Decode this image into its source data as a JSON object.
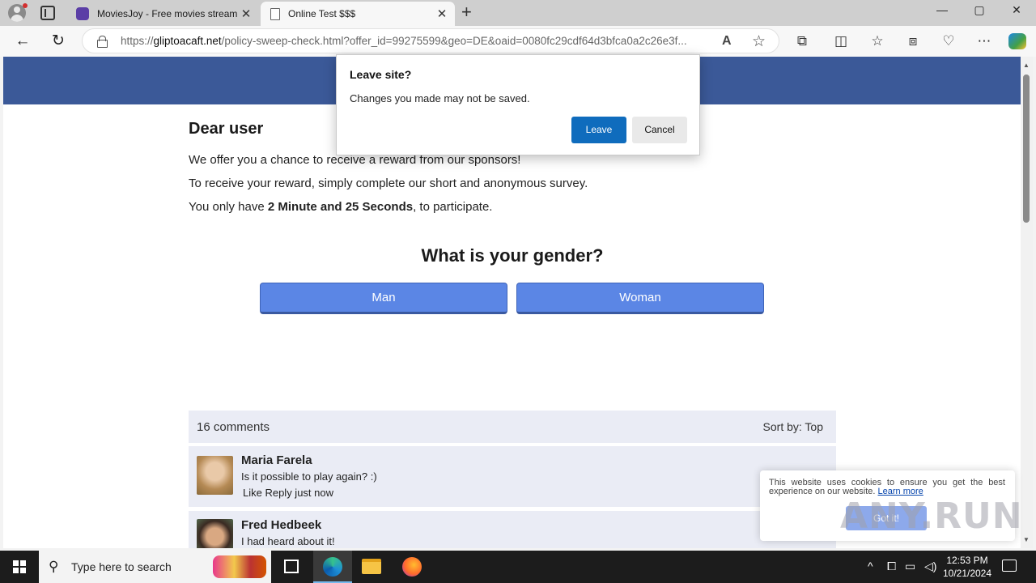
{
  "browser": {
    "tabs": [
      {
        "title": "MoviesJoy - Free movies streamin"
      },
      {
        "title": "Online Test $$$"
      }
    ],
    "url_prefix": "https://",
    "url_domain": "gliptoacaft.net",
    "url_rest": "/policy-sweep-check.html?offer_id=99275599&geo=DE&oaid=0080fc29cdf64d3bfca0a2c26e3f...",
    "win_controls": {
      "minimize": "—",
      "maximize": "▢",
      "close": "✕"
    },
    "close_tab": "✕",
    "new_tab": "+",
    "back": "←",
    "refresh": "↻",
    "read_aloud": "A",
    "favorite": "☆"
  },
  "page": {
    "greeting": "Dear user",
    "line1": "We offer you a chance to receive a reward from our sponsors!",
    "line2": "To receive your reward, simply complete our short and anonymous survey.",
    "line3_prefix": "You only have ",
    "line3_bold": "2 Minute and 25 Seconds",
    "line3_suffix": ", to participate.",
    "question": "What is your gender?",
    "answers": [
      "Man",
      "Woman"
    ],
    "comments_count": "16 comments",
    "sort_by": "Sort by:  Top",
    "comments": [
      {
        "name": "Maria Farela",
        "text": "Is it possible to play again? :)",
        "meta": "Like Reply  just now"
      },
      {
        "name": "Fred Hedbeek",
        "text": "I had heard about it!"
      }
    ]
  },
  "dialog": {
    "title": "Leave site?",
    "message": "Changes you made may not be saved.",
    "leave": "Leave",
    "cancel": "Cancel"
  },
  "cookie": {
    "text": "This website uses cookies to ensure you get the best experience on our website.",
    "link": "Learn more",
    "button": "Got it!"
  },
  "watermark": "ANY.RUN",
  "taskbar": {
    "search_placeholder": "Type here to search",
    "time": "12:53 PM",
    "date": "10/21/2024"
  },
  "colors": {
    "banner": "#3b5998",
    "answer_button": "#5b86e5",
    "dialog_primary": "#0f6cbd"
  }
}
